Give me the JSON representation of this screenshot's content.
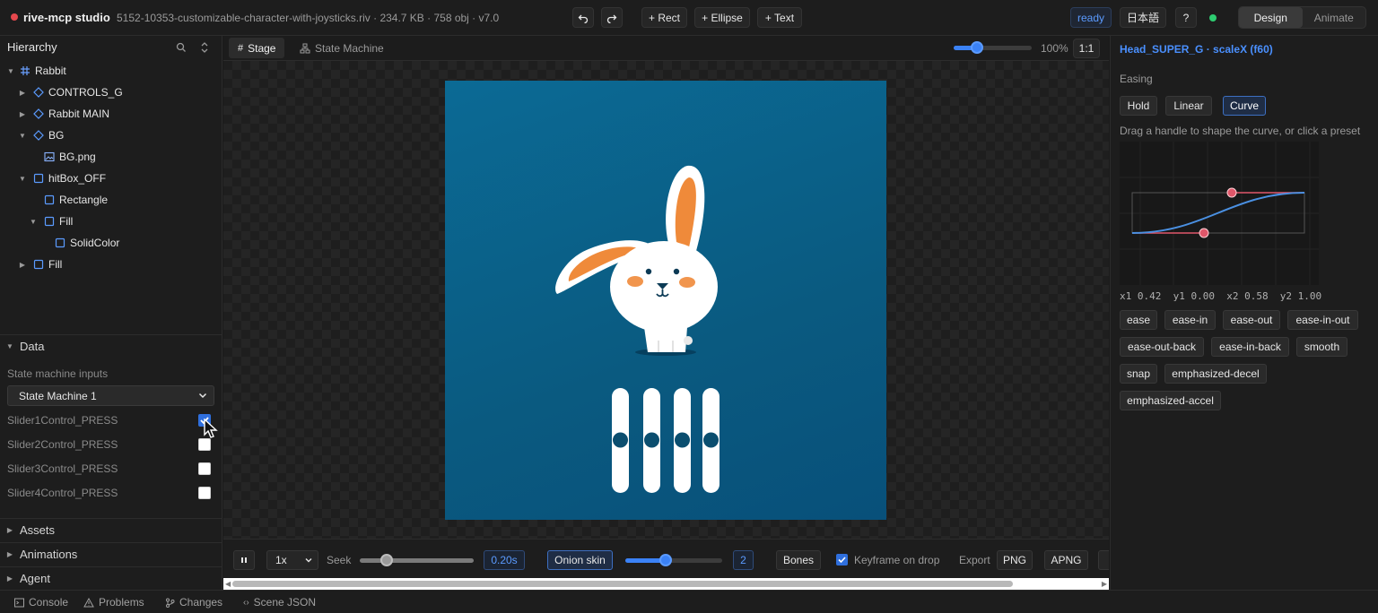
{
  "topbar": {
    "app_title": "rive-mcp studio",
    "file_meta": "5152-10353-customizable-character-with-joysticks.riv · 234.7 KB · 758 obj · v7.0",
    "add_rect": "+ Rect",
    "add_ellipse": "+ Ellipse",
    "add_text": "+ Text",
    "status": "ready",
    "language": "日本語",
    "help": "?",
    "mode_design": "Design",
    "mode_animate": "Animate"
  },
  "hierarchy": {
    "title": "Hierarchy",
    "items": [
      {
        "label": "Rabbit",
        "type": "artboard"
      },
      {
        "label": "CONTROLS_G",
        "type": "group"
      },
      {
        "label": "Rabbit MAIN",
        "type": "group"
      },
      {
        "label": "BG",
        "type": "group"
      },
      {
        "label": "BG.png",
        "type": "image"
      },
      {
        "label": "hitBox_OFF",
        "type": "shape"
      },
      {
        "label": "Rectangle",
        "type": "shape"
      },
      {
        "label": "Fill",
        "type": "shape"
      },
      {
        "label": "SolidColor",
        "type": "shape"
      },
      {
        "label": "Fill",
        "type": "shape"
      }
    ]
  },
  "data_panel": {
    "title": "Data",
    "subtitle": "State machine inputs",
    "state_machine": "State Machine 1",
    "inputs": [
      {
        "label": "Slider1Control_PRESS",
        "checked": true
      },
      {
        "label": "Slider2Control_PRESS",
        "checked": false
      },
      {
        "label": "Slider3Control_PRESS",
        "checked": false
      },
      {
        "label": "Slider4Control_PRESS",
        "checked": false
      }
    ]
  },
  "sections": {
    "assets": "Assets",
    "animations": "Animations",
    "agent": "Agent"
  },
  "center": {
    "tab_stage": "Stage",
    "tab_state_machine": "State Machine",
    "zoom": "100%",
    "zoom_fraction": 0.3,
    "reset_zoom": "1:1"
  },
  "playbar": {
    "speed": "1x",
    "seek_label": "Seek",
    "seek_fraction": 0.24,
    "time": "0.20s",
    "onion_skin": "Onion skin",
    "onion_fraction": 0.42,
    "onion_count": "2",
    "bones": "Bones",
    "keyframe_on_drop": "Keyframe on drop",
    "export_label": "Export",
    "export_png": "PNG",
    "export_apng": "APNG"
  },
  "inspector": {
    "title": "Head_SUPER_G · scaleX (f60)",
    "easing_label": "Easing",
    "modes": [
      "Hold",
      "Linear",
      "Curve"
    ],
    "active_mode": "Curve",
    "hint": "Drag a handle to shape the curve, or click a preset",
    "coords": "x1 0.42  y1 0.00  x2 0.58  y2 1.00",
    "presets": [
      "ease",
      "ease-in",
      "ease-out",
      "ease-in-out",
      "ease-out-back",
      "ease-in-back",
      "smooth",
      "snap",
      "emphasized-decel",
      "emphasized-accel"
    ]
  },
  "bottombar": {
    "console": "Console",
    "problems": "Problems",
    "changes": "Changes",
    "scene_json": "Scene JSON"
  },
  "colors": {
    "accent": "#3b82f6",
    "artboard_bg": "#0a5f88",
    "rabbit_ear_inner": "#ef8a3a",
    "handle": "#e0576a"
  }
}
